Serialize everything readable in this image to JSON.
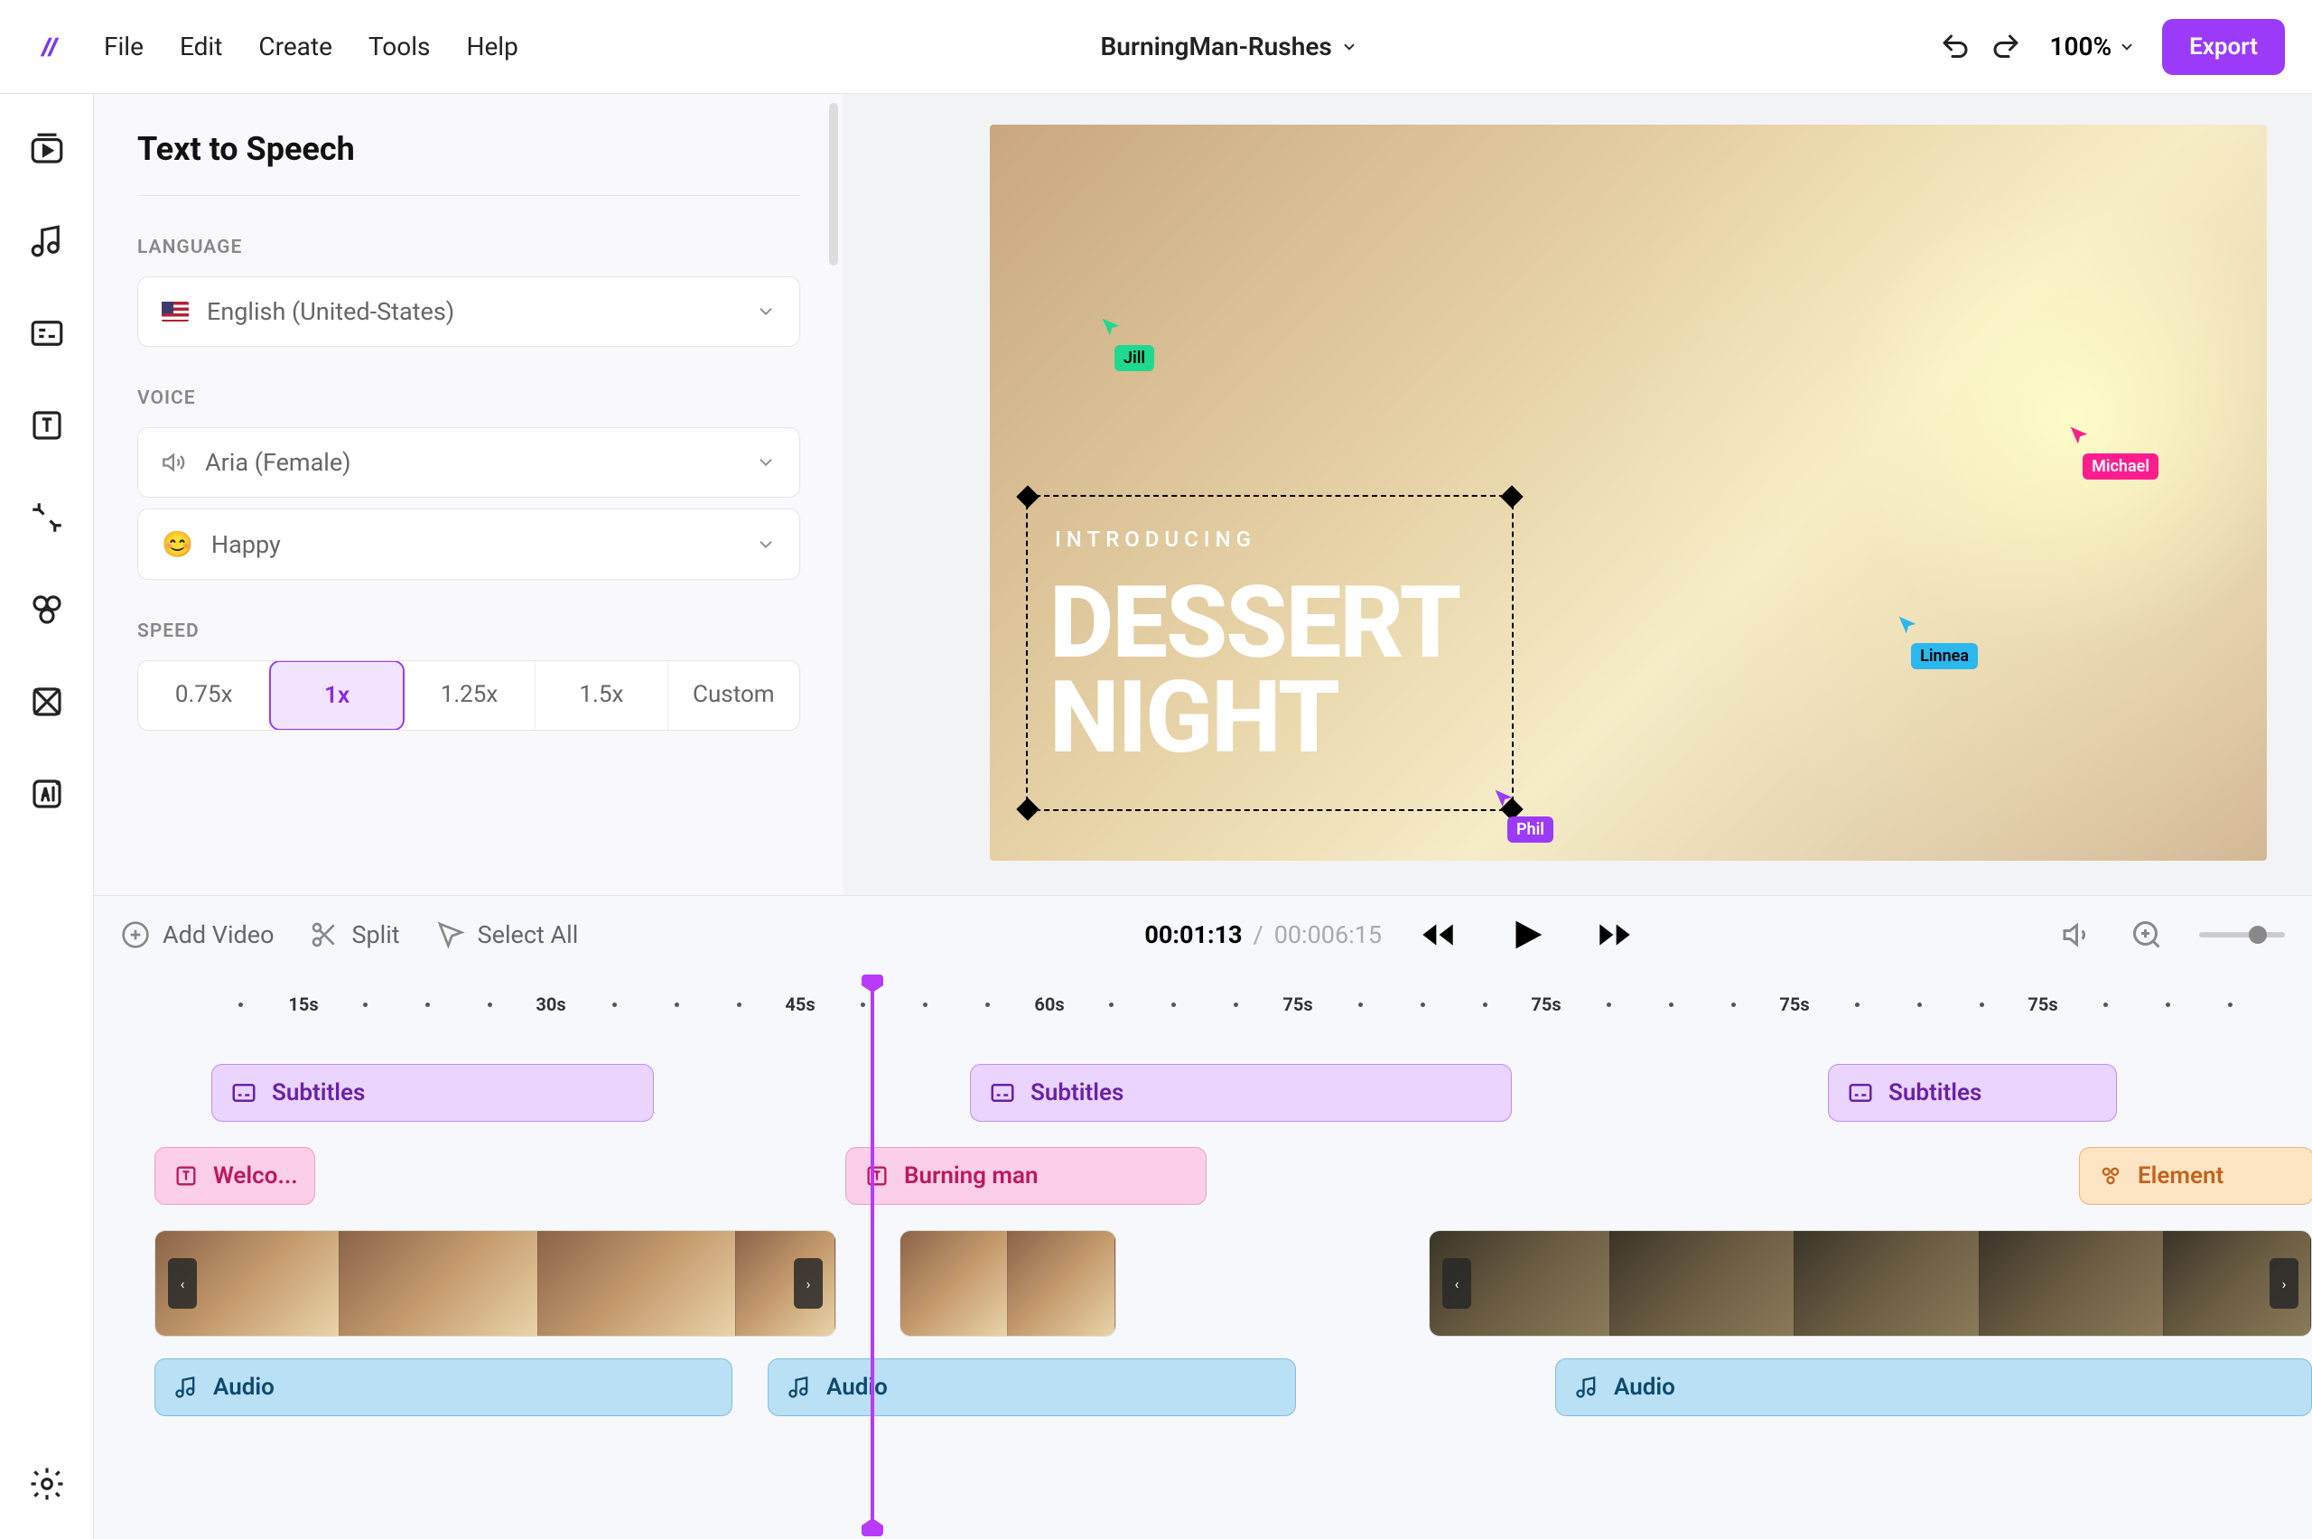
{
  "topbar": {
    "menu": [
      "File",
      "Edit",
      "Create",
      "Tools",
      "Help"
    ],
    "project_name": "BurningMan-Rushes",
    "zoom": "100%",
    "export": "Export"
  },
  "panel": {
    "title": "Text to Speech",
    "language_label": "LANGUAGE",
    "language_value": "English (United-States)",
    "voice_label": "VOICE",
    "voice_value": "Aria (Female)",
    "mood_value": "Happy",
    "speed_label": "SPEED",
    "speed_options": [
      "0.75x",
      "1x",
      "1.25x",
      "1.5x",
      "Custom"
    ],
    "speed_active": "1x"
  },
  "preview": {
    "introducing": "INTRODUCING",
    "title_line1": "DESSERT",
    "title_line2": "NIGHT"
  },
  "collaborators": {
    "jill": "Jill",
    "michael": "Michael",
    "linnea": "Linnea",
    "phil": "Phil"
  },
  "timeline": {
    "toolbar": {
      "add_video": "Add Video",
      "split": "Split",
      "select_all": "Select All"
    },
    "time_current": "00:01:13",
    "time_total": "00:006:15",
    "ruler_labels": [
      "15s",
      "30s",
      "45s",
      "60s",
      "75s",
      "75s",
      "75s",
      "75s"
    ],
    "clips": {
      "subtitles": "Subtitles",
      "welcome": "Welco...",
      "burning_man": "Burning man",
      "element": "Element",
      "audio": "Audio"
    }
  }
}
